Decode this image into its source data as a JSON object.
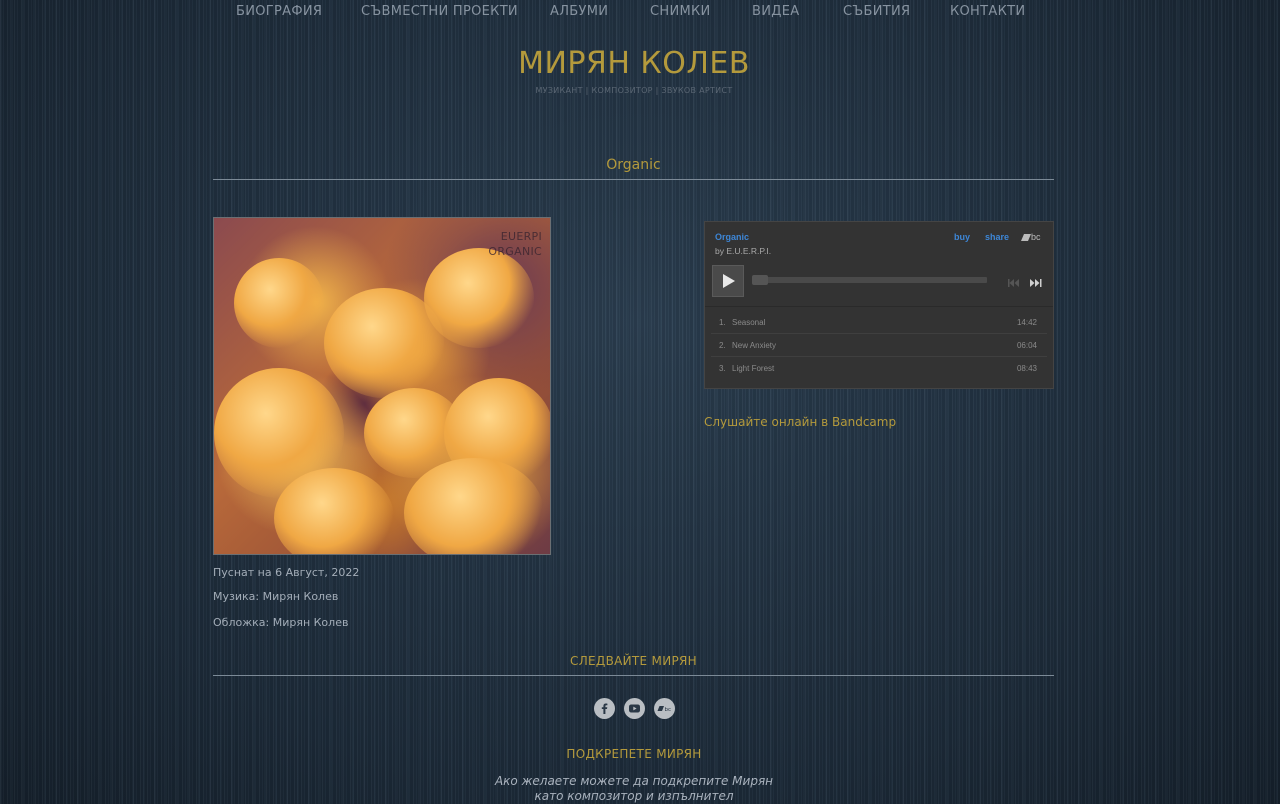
{
  "nav": {
    "items": [
      {
        "label": "БИОГРАФИЯ"
      },
      {
        "label": "СЪВМЕСТНИ ПРОЕКТИ"
      },
      {
        "label": "АЛБУМИ"
      },
      {
        "label": "СНИМКИ"
      },
      {
        "label": "ВИДЕА"
      },
      {
        "label": "СЪБИТИЯ"
      },
      {
        "label": "КОНТАКТИ"
      }
    ]
  },
  "header": {
    "title": "МИРЯН КОЛЕВ",
    "subtitle": "МУЗИКАНТ | КОМПОЗИТОР | ЗВУКОВ АРТИСТ"
  },
  "album": {
    "heading": "Organic",
    "cover_text_line1": "EUERPI",
    "cover_text_line2": "ORGANIC",
    "released": "Пуснат на 6 Август, 2022",
    "music": "Музика: Мирян Колев",
    "artwork": "Обложка: Мирян Колев",
    "listen_link": "Слушайте онлайн в Bandcamp"
  },
  "player": {
    "title": "Organic",
    "artist": "by E.U.E.R.P.I.",
    "buy_label": "buy",
    "share_label": "share",
    "logo_text": "bc",
    "progress": 0,
    "tracks": [
      {
        "num": "1.",
        "name": "Seasonal",
        "duration": "14:42"
      },
      {
        "num": "2.",
        "name": "New Anxiety",
        "duration": "06:04"
      },
      {
        "num": "3.",
        "name": "Light Forest",
        "duration": "08:43"
      }
    ]
  },
  "follow": {
    "heading": "СЛЕДВАЙТЕ МИРЯН",
    "icons": [
      "facebook-icon",
      "youtube-icon",
      "bandcamp-icon"
    ]
  },
  "support": {
    "heading": "ПОДКРЕПЕТЕ МИРЯН",
    "line1": "Ако желаете можете да подкрепите Мирян",
    "line2": "като композитор и изпълнител"
  },
  "colors": {
    "accent": "#b49a3c",
    "link_blue": "#3d86d6"
  }
}
